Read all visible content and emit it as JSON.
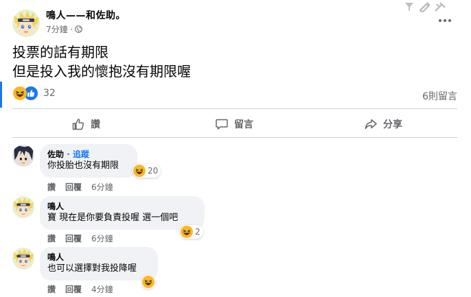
{
  "post": {
    "author": "鳴人——和佐助。",
    "time": "7分鐘 ·",
    "lines": [
      "投票的話有期限",
      "但是投入我的懷抱沒有期限喔"
    ],
    "reaction_count": "32",
    "comment_count": "6則留言"
  },
  "actions": {
    "like": "讚",
    "comment": "留言",
    "share": "分享"
  },
  "comments": [
    {
      "name": "佐助",
      "follow": "· 追蹤",
      "text": "你投胎也沒有期限",
      "reacts": "20",
      "like": "讚",
      "reply": "回覆",
      "time": "6分鐘"
    },
    {
      "name": "鳴人",
      "text": "寶 現在是你要負責投喔 選一個吧",
      "reacts": "2",
      "like": "讚",
      "reply": "回覆",
      "time": "6分鐘"
    },
    {
      "name": "鳴人",
      "text": "也可以選擇對我投降喔",
      "like": "讚",
      "reply": "回覆",
      "time": "4分鐘"
    }
  ],
  "colors": {
    "accent": "#1877f2",
    "bubble": "#f0f2f5",
    "muted": "#65676b",
    "haha": "#f7b928"
  },
  "icons": [
    "globe-icon",
    "more-icon",
    "haha-reaction-icon",
    "like-reaction-icon",
    "thumb-up-icon",
    "comment-icon",
    "share-icon"
  ]
}
